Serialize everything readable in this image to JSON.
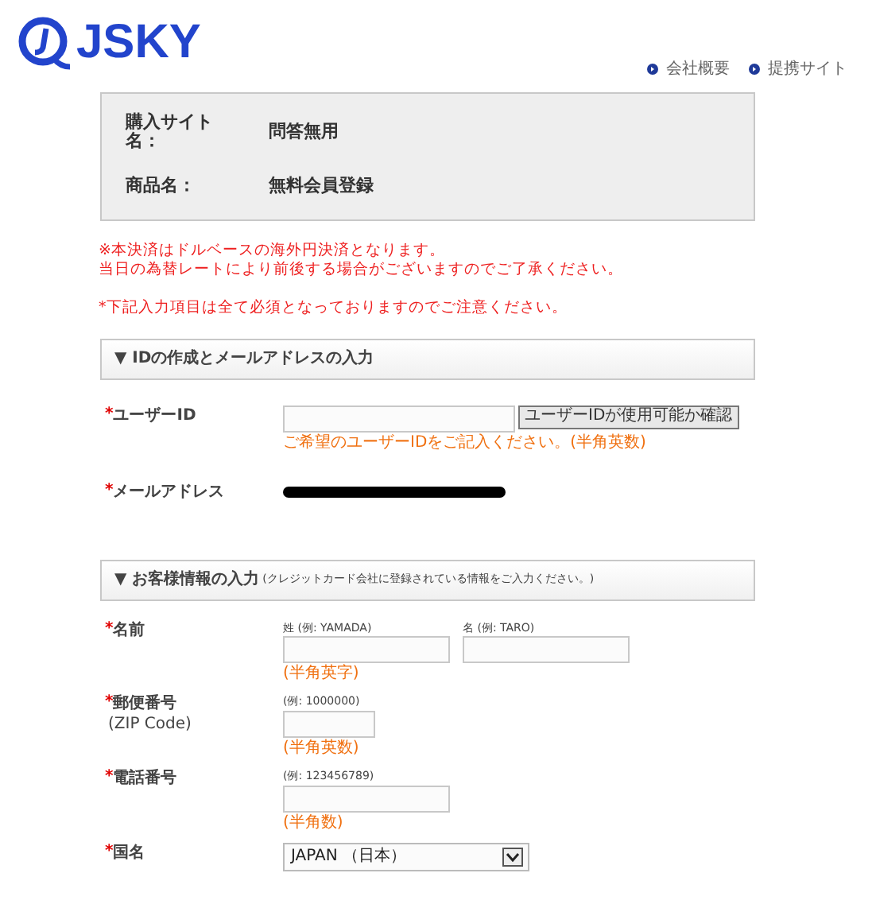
{
  "header": {
    "logo": "JSKY",
    "links": [
      "会社概要",
      "提携サイト"
    ]
  },
  "summary": [
    {
      "label": "購入サイト名：",
      "value": "問答無用"
    },
    {
      "label": "商品名：",
      "value": "無料会員登録"
    }
  ],
  "notices": [
    {
      "lines": [
        "※本決済はドルベースの海外円決済となります。",
        "当日の為替レートにより前後する場合がございますのでご了承ください。"
      ]
    },
    {
      "lines": [
        "*下記入力項目は全て必須となっておりますのでご注意ください。"
      ]
    }
  ],
  "sections": [
    {
      "title": "▼ IDの作成とメールアドレスの入力",
      "fields": [
        {
          "kind": "userid",
          "required": true,
          "mark": "*",
          "label": "ユーザーID",
          "button": "ユーザーIDが使用可能か確認",
          "hint": "ご希望のユーザーIDをご記入ください。(半角英数)"
        },
        {
          "kind": "redacted",
          "required": true,
          "mark": "*",
          "label": "メールアドレス"
        }
      ]
    },
    {
      "title": "▼ お客様情報の入力",
      "note": "(クレジットカード会社に登録されている情報をご入力ください。)",
      "fields": [
        {
          "kind": "name",
          "required": true,
          "mark": "*",
          "label": "名前",
          "captions": [
            "姓 (例: YAMADA)",
            "名 (例: TARO)"
          ],
          "hint": "(半角英字)"
        },
        {
          "kind": "zip",
          "required": true,
          "mark": "*",
          "label": "郵便番号",
          "sublabel": "(ZIP Code)",
          "captions": [
            "(例: 1000000)"
          ],
          "hint": "(半角英数)"
        },
        {
          "kind": "phone",
          "required": true,
          "mark": "*",
          "label": "電話番号",
          "captions": [
            "(例: 123456789)"
          ],
          "hint": "(半角数)"
        },
        {
          "kind": "country",
          "required": true,
          "mark": "*",
          "label": "国名",
          "value": "JAPAN （日本）"
        }
      ]
    }
  ]
}
